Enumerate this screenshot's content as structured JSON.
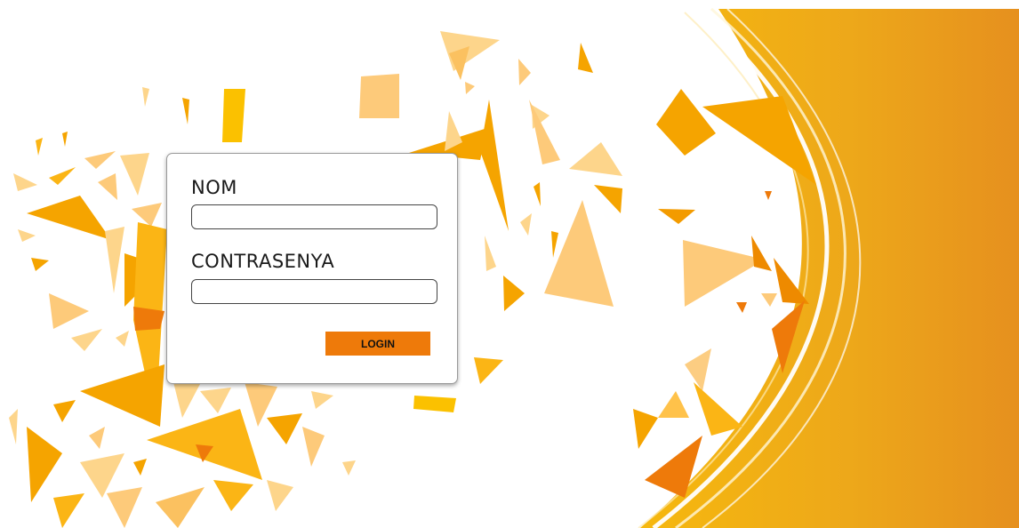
{
  "colors": {
    "accent_light": "#fdd58b",
    "accent": "#fbb515",
    "accent_dark": "#ee7a0a",
    "background": "#ffffff"
  },
  "login_form": {
    "username_label": "NOM",
    "username_value": "",
    "password_label": "CONTRASENYA",
    "password_value": "",
    "submit_label": "LOGIN"
  }
}
